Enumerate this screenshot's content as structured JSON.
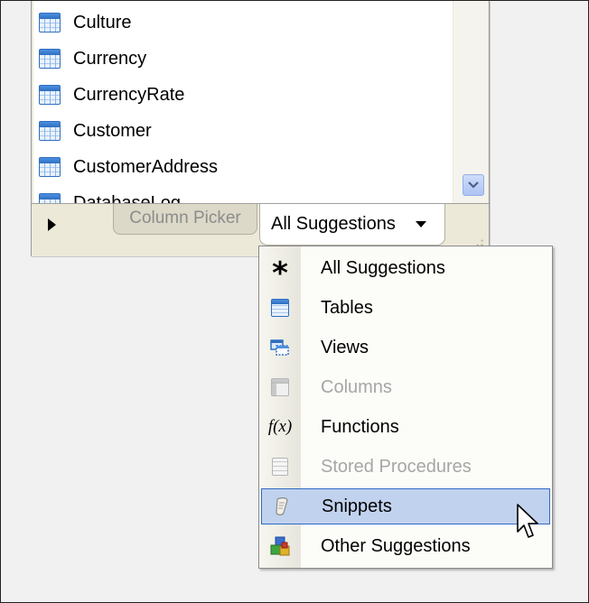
{
  "window": {
    "list_items": [
      {
        "label": "Culture",
        "icon": "table-icon"
      },
      {
        "label": "Currency",
        "icon": "table-icon"
      },
      {
        "label": "CurrencyRate",
        "icon": "table-icon"
      },
      {
        "label": "Customer",
        "icon": "table-icon"
      },
      {
        "label": "CustomerAddress",
        "icon": "table-icon"
      },
      {
        "label": "DatabaseLog",
        "icon": "table-icon"
      }
    ],
    "tabs": {
      "inactive_label": "Column Picker",
      "active_label": "All Suggestions"
    }
  },
  "menu": {
    "items": [
      {
        "label": "All Suggestions",
        "icon": "asterisk-icon",
        "enabled": true
      },
      {
        "label": "Tables",
        "icon": "table-icon",
        "enabled": true
      },
      {
        "label": "Views",
        "icon": "view-icon",
        "enabled": true
      },
      {
        "label": "Columns",
        "icon": "columns-icon",
        "enabled": false
      },
      {
        "label": "Functions",
        "icon": "function-icon",
        "enabled": true
      },
      {
        "label": "Stored Procedures",
        "icon": "stored-procedure-icon",
        "enabled": false
      },
      {
        "label": "Snippets",
        "icon": "snippet-icon",
        "enabled": true,
        "selected": true
      },
      {
        "label": "Other Suggestions",
        "icon": "other-suggestions-icon",
        "enabled": true
      }
    ],
    "function_glyph": "f(x)",
    "asterisk_glyph": "*"
  },
  "colors": {
    "selection_fill": "#c1d2ee",
    "selection_border": "#316ac5",
    "disabled_text": "#a6a6a6"
  }
}
